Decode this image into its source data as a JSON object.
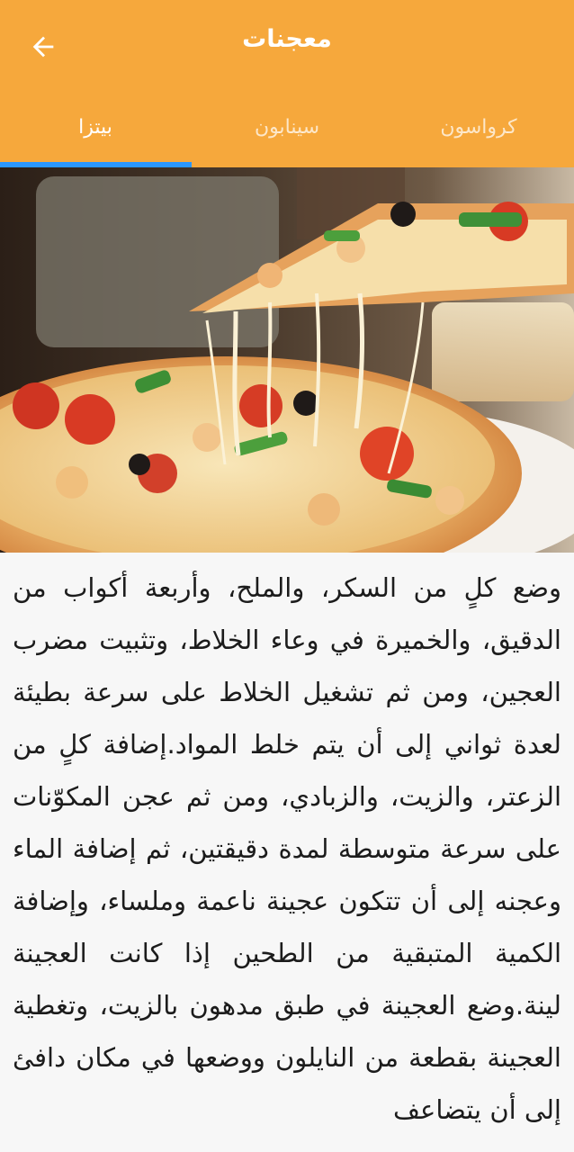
{
  "header": {
    "title": "معجنات",
    "back_icon": "arrow-back-icon",
    "background_color": "#f6a83c",
    "indicator_color": "#2a97ff"
  },
  "tabs": [
    {
      "label": "كرواسون",
      "active": false
    },
    {
      "label": "سينابون",
      "active": false
    },
    {
      "label": "بيتزا",
      "active": true
    }
  ],
  "hero": {
    "subject": "pizza-photo"
  },
  "content": {
    "text": "وضع كلٍ من السكر، والملح، وأربعة أكواب من الدقيق، والخميرة في وعاء الخلاط، وتثبيت مضرب العجين، ومن ثم تشغيل الخلاط على سرعة بطيئة لعدة ثواني إلى أن يتم خلط المواد.إضافة كلٍ من الزعتر، والزيت، والزبادي، ومن ثم عجن المكوّنات على سرعة متوسطة لمدة دقيقتين، ثم إضافة الماء وعجنه إلى أن تتكون عجينة ناعمة وملساء، وإضافة الكمية المتبقية من الطحين إذا كانت العجينة لينة.وضع العجينة في طبق مدهون بالزيت، وتغطية العجينة بقطعة من النايلون ووضعها في مكان دافئ إلى أن يتضاعف"
  }
}
